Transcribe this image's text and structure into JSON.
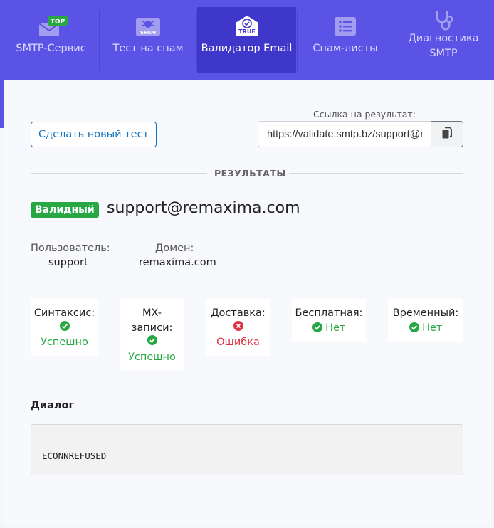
{
  "nav": {
    "items": [
      {
        "label": "SMTP-Сервис",
        "badge": "TOP"
      },
      {
        "label": "Тест на спам",
        "icon_text": "SPAM"
      },
      {
        "label": "Валидатор Email",
        "icon_text": "TRUE"
      },
      {
        "label": "Спам-листы"
      },
      {
        "label": "Диагностика SMTP"
      }
    ]
  },
  "toolbar": {
    "new_test_label": "Сделать новый тест",
    "link_label": "Ссылка на результат:",
    "link_value": "https://validate.smtp.bz/support@remaxima.com"
  },
  "results": {
    "section_title": "РЕЗУЛЬТАТЫ",
    "status_badge": "Валидный",
    "email": "support@remaxima.com",
    "user_label": "Пользователь:",
    "user_value": "support",
    "domain_label": "Домен:",
    "domain_value": "remaxima.com"
  },
  "checks": [
    {
      "label": "Синтаксис:",
      "value": "Успешно",
      "status": "ok"
    },
    {
      "label": "MX-записи:",
      "value": "Успешно",
      "status": "ok"
    },
    {
      "label": "Доставка:",
      "value": "Ошибка",
      "status": "error"
    },
    {
      "label": "Бесплатная:",
      "value": "Нет",
      "status": "ok"
    },
    {
      "label": "Временный:",
      "value": "Нет",
      "status": "ok"
    }
  ],
  "dialog": {
    "title": "Диалог",
    "content": "ECONNREFUSED"
  },
  "colors": {
    "nav_bg": "#5b53e5",
    "nav_active": "#3f37c9",
    "success": "#28a745",
    "error": "#dc3545",
    "link": "#0d72c4"
  }
}
